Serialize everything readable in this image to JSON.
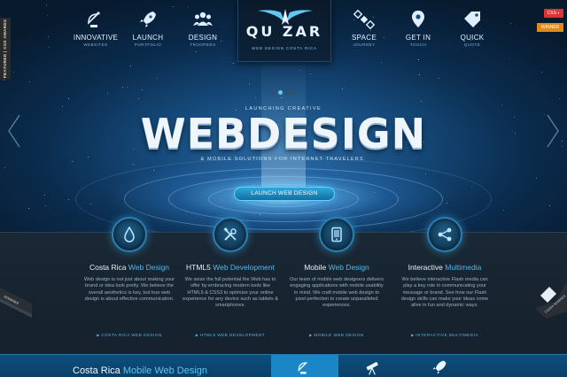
{
  "nav": {
    "left": [
      {
        "label": "INNOVATIVE",
        "sub": "WEBSITES",
        "icon": "satellite-dish-icon"
      },
      {
        "label": "LAUNCH",
        "sub": "PORTFOLIO",
        "icon": "rocket-icon"
      },
      {
        "label": "DESIGN",
        "sub": "TROOPERS",
        "icon": "team-icon"
      }
    ],
    "right": [
      {
        "label": "SPACE",
        "sub": "JOURNEY",
        "icon": "satellite-icon"
      },
      {
        "label": "GET IN",
        "sub": "TOUCH",
        "icon": "location-pin-icon"
      },
      {
        "label": "QUICK",
        "sub": "QUOTE",
        "icon": "price-tag-icon"
      }
    ]
  },
  "logo": {
    "text": "QU  ZAR",
    "subtitle": "WEB DESIGN COSTA RICA"
  },
  "featured": "FEATURED | CSS AWARDS",
  "badges": {
    "css": "CSS ◐",
    "winner": "WINNER"
  },
  "hero": {
    "kicker": "LAUNCHING CREATIVE",
    "title": "WEBDESIGN",
    "tagline": "& MOBILE SOLUTIONS FOR INTERNET TRAVELERS.",
    "cta": "LAUNCH WEB DESIGN",
    "slides": 4,
    "active_slide": 2
  },
  "services": [
    {
      "icon": "water-drop-icon",
      "title_plain": "Costa Rica ",
      "title_hl": "Web Design",
      "body": "Web design is not just about making your brand or idea look pretty. We believe the overall aesthetics is key, but true web design is about effective communication.",
      "more": "COSTA RICA WEB DESIGN"
    },
    {
      "icon": "tools-icon",
      "title_plain": "HTML5 ",
      "title_hl": "Web Development",
      "body": "We seize the full potential the Web has to offer by embracing modern tools like HTML5 & CSS3 to optimize your online experience for any device such as tablets & smartphones.",
      "more": "HTML5 WEB DEVELOPMENT"
    },
    {
      "icon": "tablet-icon",
      "title_plain": "Mobile ",
      "title_hl": "Web Design",
      "body": "Our team of mobile web designers delivers engaging applications with mobile usability in mind. We craft mobile web design to pixel perfection to create unparalleled experiences.",
      "more": "MOBILE WEB DESIGN"
    },
    {
      "icon": "share-icon",
      "title_plain": "Interactive ",
      "title_hl": "Multimedia",
      "body": "We believe interactive Flash media can play a key role in communicating your message or brand. See how our Flash design skills can make your ideas come alive in fun and dynamic ways.",
      "more": "INTERACTIVE MULTIMEDIA"
    }
  ],
  "ribbons": {
    "left": "NOMINEE",
    "right": "CSSDA NOMINEE"
  },
  "bottom": {
    "title_plain": "Costa Rica ",
    "title_hl": "Mobile Web Design",
    "tabs": [
      "satellite-dish-icon",
      "telescope-icon",
      "rocket-icon"
    ],
    "active_tab": 0
  },
  "colors": {
    "accent": "#4fb8ee",
    "hero_dark": "#071a2e",
    "panel": "#1a2835",
    "cta": "#2ea8dd"
  }
}
